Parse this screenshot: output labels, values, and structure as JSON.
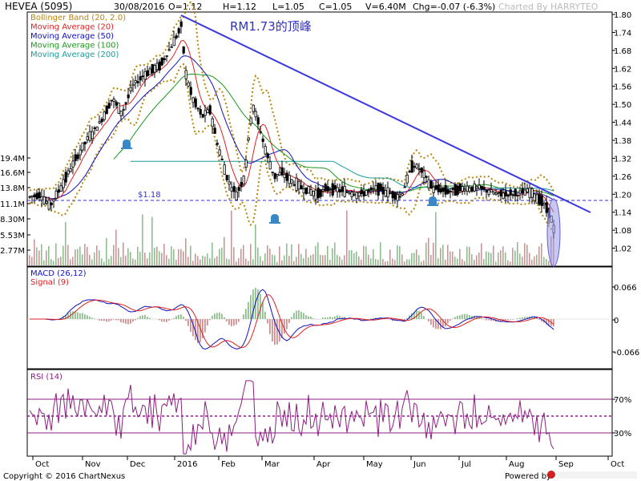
{
  "header": {
    "symbol": "HEVEA (5095)",
    "date": "30/08/2016",
    "open": "O=1.12",
    "high": "H=1.12",
    "low": "L=1.05",
    "close": "C=1.05",
    "volume": "V=6.40M",
    "change": "Chg=-0.07 (-6.3%)",
    "charted_by": "Charted By HARRYTEO"
  },
  "annotation": "RM1.73的顶峰",
  "price_label": "$1.18",
  "legend": [
    {
      "label": "Bollinger Band (20, 2.0)",
      "color": "#b8860b"
    },
    {
      "label": "Moving Average (20)",
      "color": "#e02020"
    },
    {
      "label": "Moving Average (50)",
      "color": "#1010c0"
    },
    {
      "label": "Moving Average (100)",
      "color": "#1a9a1a"
    },
    {
      "label": "Moving Average (200)",
      "color": "#1a9a9a"
    }
  ],
  "macd_panel": {
    "labels": [
      {
        "label": "MACD (26,12)",
        "color": "#1010c0"
      },
      {
        "label": "Signal (9)",
        "color": "#e02020"
      }
    ],
    "ticks": [
      "0.066",
      "0",
      "-0.066"
    ]
  },
  "rsi_panel": {
    "label": "RSI (14)",
    "ticks": [
      "70%",
      "30%"
    ]
  },
  "footer": {
    "copyright": "Copyright © 2016 ChartNexus",
    "powered": "Powered by"
  },
  "chart_data": {
    "type": "line",
    "ticker": "HEVEA (5095)",
    "x_months": [
      "Oct",
      "Nov",
      "Dec",
      "2016",
      "Feb",
      "Mar",
      "Apr",
      "May",
      "Jun",
      "Jul",
      "Aug",
      "Sep",
      "Oct"
    ],
    "y_price_ticks": [
      "1.80",
      "1.74",
      "1.68",
      "1.62",
      "1.56",
      "1.50",
      "1.44",
      "1.38",
      "1.32",
      "1.26",
      "1.20",
      "1.14",
      "1.08",
      "1.02"
    ],
    "ylim_price": [
      0.96,
      1.8
    ],
    "volume_ticks": [
      "19.4M",
      "16.6M",
      "13.8M",
      "11.1M",
      "8.30M",
      "5.53M",
      "2.77M"
    ],
    "support_level": 1.18,
    "peak_annotation": "RM1.73的顶峰",
    "close_approx": [
      {
        "month": "Oct",
        "value": 1.18
      },
      {
        "month": "Nov",
        "value": 1.36
      },
      {
        "month": "Dec",
        "value": 1.6
      },
      {
        "month": "2016",
        "value": 1.76
      },
      {
        "month": "Feb",
        "value": 1.22
      },
      {
        "month": "Mar",
        "value": 1.22
      },
      {
        "month": "Apr",
        "value": 1.2
      },
      {
        "month": "May",
        "value": 1.2
      },
      {
        "month": "Jun",
        "value": 1.26
      },
      {
        "month": "Jul",
        "value": 1.22
      },
      {
        "month": "Aug",
        "value": 1.2
      },
      {
        "month": "end",
        "value": 1.05
      }
    ]
  }
}
